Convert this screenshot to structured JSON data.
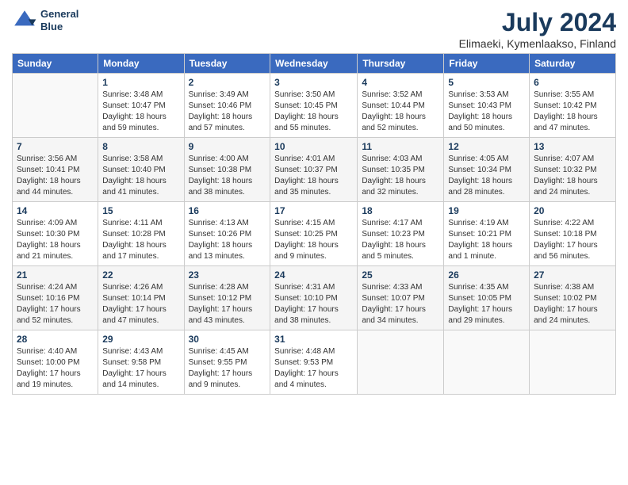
{
  "logo": {
    "line1": "General",
    "line2": "Blue"
  },
  "title": "July 2024",
  "location": "Elimaeki, Kymenlaakso, Finland",
  "days_header": [
    "Sunday",
    "Monday",
    "Tuesday",
    "Wednesday",
    "Thursday",
    "Friday",
    "Saturday"
  ],
  "weeks": [
    [
      {
        "num": "",
        "detail": ""
      },
      {
        "num": "1",
        "detail": "Sunrise: 3:48 AM\nSunset: 10:47 PM\nDaylight: 18 hours\nand 59 minutes."
      },
      {
        "num": "2",
        "detail": "Sunrise: 3:49 AM\nSunset: 10:46 PM\nDaylight: 18 hours\nand 57 minutes."
      },
      {
        "num": "3",
        "detail": "Sunrise: 3:50 AM\nSunset: 10:45 PM\nDaylight: 18 hours\nand 55 minutes."
      },
      {
        "num": "4",
        "detail": "Sunrise: 3:52 AM\nSunset: 10:44 PM\nDaylight: 18 hours\nand 52 minutes."
      },
      {
        "num": "5",
        "detail": "Sunrise: 3:53 AM\nSunset: 10:43 PM\nDaylight: 18 hours\nand 50 minutes."
      },
      {
        "num": "6",
        "detail": "Sunrise: 3:55 AM\nSunset: 10:42 PM\nDaylight: 18 hours\nand 47 minutes."
      }
    ],
    [
      {
        "num": "7",
        "detail": "Sunrise: 3:56 AM\nSunset: 10:41 PM\nDaylight: 18 hours\nand 44 minutes."
      },
      {
        "num": "8",
        "detail": "Sunrise: 3:58 AM\nSunset: 10:40 PM\nDaylight: 18 hours\nand 41 minutes."
      },
      {
        "num": "9",
        "detail": "Sunrise: 4:00 AM\nSunset: 10:38 PM\nDaylight: 18 hours\nand 38 minutes."
      },
      {
        "num": "10",
        "detail": "Sunrise: 4:01 AM\nSunset: 10:37 PM\nDaylight: 18 hours\nand 35 minutes."
      },
      {
        "num": "11",
        "detail": "Sunrise: 4:03 AM\nSunset: 10:35 PM\nDaylight: 18 hours\nand 32 minutes."
      },
      {
        "num": "12",
        "detail": "Sunrise: 4:05 AM\nSunset: 10:34 PM\nDaylight: 18 hours\nand 28 minutes."
      },
      {
        "num": "13",
        "detail": "Sunrise: 4:07 AM\nSunset: 10:32 PM\nDaylight: 18 hours\nand 24 minutes."
      }
    ],
    [
      {
        "num": "14",
        "detail": "Sunrise: 4:09 AM\nSunset: 10:30 PM\nDaylight: 18 hours\nand 21 minutes."
      },
      {
        "num": "15",
        "detail": "Sunrise: 4:11 AM\nSunset: 10:28 PM\nDaylight: 18 hours\nand 17 minutes."
      },
      {
        "num": "16",
        "detail": "Sunrise: 4:13 AM\nSunset: 10:26 PM\nDaylight: 18 hours\nand 13 minutes."
      },
      {
        "num": "17",
        "detail": "Sunrise: 4:15 AM\nSunset: 10:25 PM\nDaylight: 18 hours\nand 9 minutes."
      },
      {
        "num": "18",
        "detail": "Sunrise: 4:17 AM\nSunset: 10:23 PM\nDaylight: 18 hours\nand 5 minutes."
      },
      {
        "num": "19",
        "detail": "Sunrise: 4:19 AM\nSunset: 10:21 PM\nDaylight: 18 hours\nand 1 minute."
      },
      {
        "num": "20",
        "detail": "Sunrise: 4:22 AM\nSunset: 10:18 PM\nDaylight: 17 hours\nand 56 minutes."
      }
    ],
    [
      {
        "num": "21",
        "detail": "Sunrise: 4:24 AM\nSunset: 10:16 PM\nDaylight: 17 hours\nand 52 minutes."
      },
      {
        "num": "22",
        "detail": "Sunrise: 4:26 AM\nSunset: 10:14 PM\nDaylight: 17 hours\nand 47 minutes."
      },
      {
        "num": "23",
        "detail": "Sunrise: 4:28 AM\nSunset: 10:12 PM\nDaylight: 17 hours\nand 43 minutes."
      },
      {
        "num": "24",
        "detail": "Sunrise: 4:31 AM\nSunset: 10:10 PM\nDaylight: 17 hours\nand 38 minutes."
      },
      {
        "num": "25",
        "detail": "Sunrise: 4:33 AM\nSunset: 10:07 PM\nDaylight: 17 hours\nand 34 minutes."
      },
      {
        "num": "26",
        "detail": "Sunrise: 4:35 AM\nSunset: 10:05 PM\nDaylight: 17 hours\nand 29 minutes."
      },
      {
        "num": "27",
        "detail": "Sunrise: 4:38 AM\nSunset: 10:02 PM\nDaylight: 17 hours\nand 24 minutes."
      }
    ],
    [
      {
        "num": "28",
        "detail": "Sunrise: 4:40 AM\nSunset: 10:00 PM\nDaylight: 17 hours\nand 19 minutes."
      },
      {
        "num": "29",
        "detail": "Sunrise: 4:43 AM\nSunset: 9:58 PM\nDaylight: 17 hours\nand 14 minutes."
      },
      {
        "num": "30",
        "detail": "Sunrise: 4:45 AM\nSunset: 9:55 PM\nDaylight: 17 hours\nand 9 minutes."
      },
      {
        "num": "31",
        "detail": "Sunrise: 4:48 AM\nSunset: 9:53 PM\nDaylight: 17 hours\nand 4 minutes."
      },
      {
        "num": "",
        "detail": ""
      },
      {
        "num": "",
        "detail": ""
      },
      {
        "num": "",
        "detail": ""
      }
    ]
  ]
}
